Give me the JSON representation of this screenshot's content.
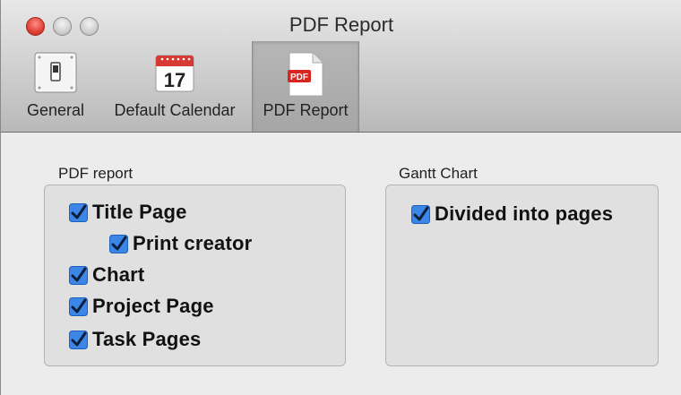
{
  "window": {
    "title": "PDF Report"
  },
  "toolbar": {
    "items": [
      {
        "label": "General",
        "icon": "switch-icon",
        "selected": false
      },
      {
        "label": "Default Calendar",
        "icon": "calendar-icon",
        "calendar_day": "17",
        "selected": false
      },
      {
        "label": "PDF Report",
        "icon": "pdf-document-icon",
        "badge": "PDF",
        "selected": true
      }
    ]
  },
  "pdf_report": {
    "title": "PDF report",
    "options": [
      {
        "label": "Title Page",
        "checked": true
      },
      {
        "label": "Print creator",
        "checked": true
      },
      {
        "label": "Chart",
        "checked": true
      },
      {
        "label": "Project Page",
        "checked": true
      },
      {
        "label": "Task Pages",
        "checked": true
      }
    ]
  },
  "gantt_chart": {
    "title": "Gantt Chart",
    "options": [
      {
        "label": "Divided into pages",
        "checked": true
      }
    ]
  },
  "colors": {
    "checkbox": "#3b86e6",
    "close_button": "#e2463c"
  }
}
